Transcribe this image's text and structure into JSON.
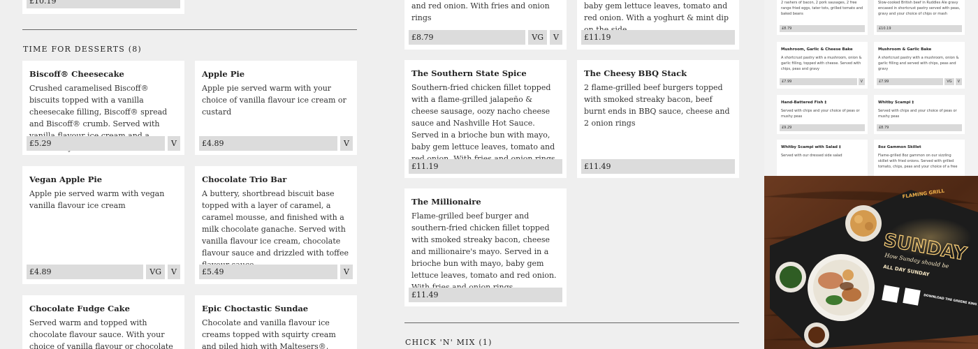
{
  "left": {
    "prev_price": "£10.19",
    "section_title": "TIME FOR DESSERTS (8)",
    "items": [
      {
        "name": "Biscoff® Cheesecake",
        "desc": "Crushed caramelised Biscoff® biscuits topped with a vanilla cheesecake filling, Biscoff® spread and Biscoff® crumb. Served with vanilla flavour ice cream and a strawberry",
        "price": "£5.29",
        "tags": [
          "V"
        ]
      },
      {
        "name": "Apple Pie",
        "desc": "Apple pie served warm with your choice of vanilla flavour ice cream or custard",
        "price": "£4.89",
        "tags": [
          "V"
        ]
      },
      {
        "name": "Vegan Apple Pie",
        "desc": "Apple pie served warm with vegan vanilla flavour ice cream",
        "price": "£4.89",
        "tags": [
          "VG",
          "V"
        ]
      },
      {
        "name": "Chocolate Trio Bar",
        "desc": "A buttery, shortbread biscuit base topped with a layer of caramel, a caramel mousse, and finished with a milk chocolate ganache. Served with vanilla flavour ice cream, chocolate flavour sauce and drizzled with toffee flavour sauce",
        "price": "£5.49",
        "tags": [
          "V"
        ]
      },
      {
        "name": "Chocolate Fudge Cake",
        "desc": "Served warm and topped with chocolate flavour sauce. With your choice of vanilla flavour or chocolate flavour ice cream"
      },
      {
        "name": "Epic Choctastic Sundae",
        "desc": "Chocolate and vanilla flavour ice creams topped with squirty cream and piled high with Maltesers®, Cadbury® Crunchie pieces and"
      }
    ]
  },
  "mid": {
    "top_left_desc": "and red onion. With fries and onion rings",
    "top_left_price": "£8.79",
    "top_left_tags": [
      "VG",
      "V"
    ],
    "top_right_desc": "baby gem lettuce leaves, tomato and red onion. With a yoghurt & mint dip on the side",
    "top_right_price": "£11.19",
    "items": [
      {
        "name": "The Southern State Spice",
        "desc": "Southern-fried chicken fillet topped with a flame-grilled jalapeño & cheese sausage, oozy nacho cheese sauce and Nashville Hot Sauce. Served in a brioche bun with mayo, baby gem lettuce leaves, tomato and red onion. With fries and onion rings",
        "price": "£11.19"
      },
      {
        "name": "The Cheesy BBQ Stack",
        "desc": "2 flame-grilled beef burgers topped with smoked streaky bacon, beef burnt ends in BBQ sauce, cheese and 2 onion rings",
        "price": "£11.49"
      },
      {
        "name": "The Millionaire",
        "desc": "Flame-grilled beef burger and southern-fried chicken fillet topped with smoked streaky bacon, cheese and millionaire's mayo. Served in a brioche bun with mayo, baby gem lettuce leaves, tomato and red onion. With fries and onion rings",
        "price": "£11.49"
      }
    ],
    "section_title": "CHICK 'N' MIX (1)"
  },
  "right": {
    "mini_items": [
      {
        "name": "",
        "desc": "2 rashers of bacon, 2 pork sausages, 2 free range fried eggs, tater tots, grilled tomato and baked beans",
        "price": "£8.79",
        "tags": []
      },
      {
        "name": "",
        "desc": "Slow-cooked British beef in Ruddles Ale gravy encased in shortcrust pastry served with peas, gravy and your choice of chips or mash",
        "price": "£10.19",
        "tags": []
      },
      {
        "name": "Mushroom, Garlic & Cheese Bake",
        "desc": "A shortcrust pastry with a mushroom, onion & garlic filling, topped with cheese. Served with chips, peas and gravy",
        "price": "£7.99",
        "tags": [
          "V"
        ]
      },
      {
        "name": "Mushroom & Garlic Bake",
        "desc": "A shortcrust pastry with a mushroom, onion & garlic filling and served with chips, peas and gravy",
        "price": "£7.99",
        "tags": [
          "VG",
          "V"
        ]
      },
      {
        "name": "Hand-Battered Fish ‡",
        "desc": "Served with chips and your choice of peas or mushy peas",
        "price": "£9.29",
        "tags": []
      },
      {
        "name": "Whitby Scampi ‡",
        "desc": "Served with chips and your choice of peas or mushy peas",
        "price": "£8.79",
        "tags": []
      },
      {
        "name": "Whitby Scampi with Salad ‡",
        "desc": "Served with our dressed side salad",
        "price": "",
        "tags": []
      },
      {
        "name": "8oz Gammon Skillet",
        "desc": "Flame-grilled 8oz gammon on our sizzling skillet with fried onions. Served with grilled tomato, chips, peas and your choice of a free",
        "price": "",
        "tags": []
      }
    ],
    "promo": {
      "brand": "FLAMING GRILL",
      "headline": "SUNDAY",
      "tagline": "How Sunday should be",
      "subline": "ALL DAY SUNDAY",
      "app_text": "DOWNLOAD THE GREENE KING APP",
      "colors": {
        "table_wood": "#5a2f1a",
        "card": "#1c1c1c",
        "accent": "#f2b24a"
      }
    }
  }
}
